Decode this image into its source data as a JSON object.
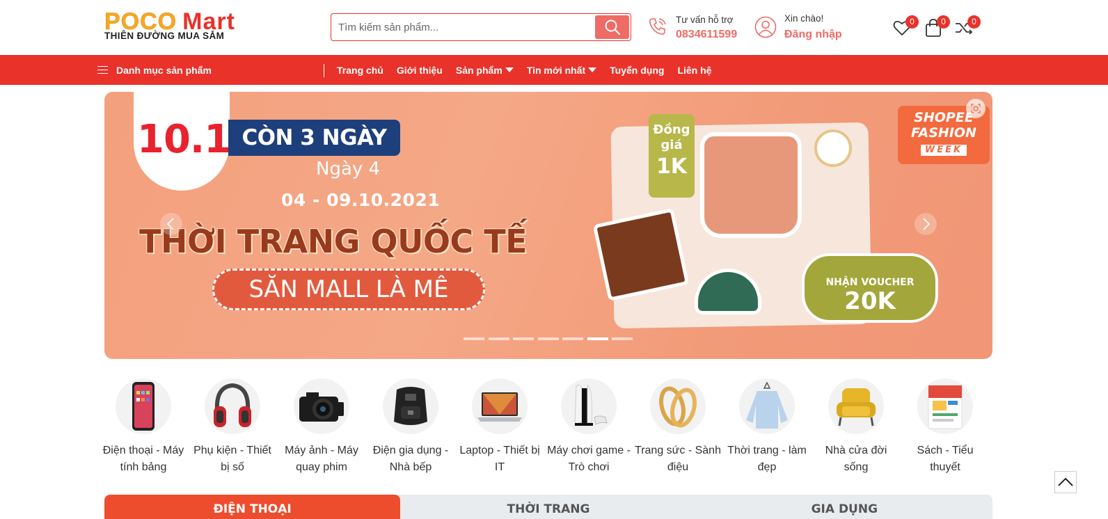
{
  "header": {
    "logo_poco": "POCO",
    "logo_mart": "Mart",
    "logo_tagline": "THIÊN ĐƯỜNG MUA SẮM",
    "search_placeholder": "Tìm kiếm sản phẩm...",
    "support_label": "Tư vấn hỗ trợ",
    "support_phone": "0834611599",
    "greeting": "Xin chào!",
    "login_label": "Đăng nhập",
    "wishlist_count": "0",
    "cart_count": "0",
    "compare_count": "0"
  },
  "nav": {
    "category_menu": "Danh mục sản phẩm",
    "links": [
      "Trang chủ",
      "Giới thiệu",
      "Sản phẩm",
      "Tin mới nhất",
      "Tuyển dụng",
      "Liên hệ"
    ]
  },
  "banner": {
    "date_big": "10.10",
    "countdown": "CÒN 3 NGÀY",
    "day": "Ngày 4",
    "date_range": "04 - 09.10.2021",
    "headline": "THỜI TRANG QUỐC TẾ",
    "pill": "SĂN MALL LÀ MÊ",
    "dongia_line1": "Đồng",
    "dongia_line2": "giá",
    "dongia_price": "1K",
    "voucher_line": "NHẬN VOUCHER",
    "voucher_value": "20K",
    "shopee_line1": "SHOPEE",
    "shopee_line2": "FASHION",
    "shopee_line3": "WEEK",
    "slide_count": 7,
    "active_slide": 6
  },
  "categories": [
    {
      "line1": "Điện thoại - Máy",
      "line2": "tính bảng",
      "icon": "phone-icon"
    },
    {
      "line1": "Phụ kiện - Thiết",
      "line2": "bị số",
      "icon": "headphones-icon"
    },
    {
      "line1": "Máy ảnh - Máy",
      "line2": "quay phim",
      "icon": "camera-icon"
    },
    {
      "line1": "Điện gia dụng -",
      "line2": "Nhà bếp",
      "icon": "air-fryer-icon"
    },
    {
      "line1": "Laptop - Thiết bị",
      "line2": "IT",
      "icon": "laptop-icon"
    },
    {
      "line1": "Máy chơi game -",
      "line2": "Trò chơi",
      "icon": "game-console-icon"
    },
    {
      "line1": "Trang sức - Sành",
      "line2": "điệu",
      "icon": "rings-icon"
    },
    {
      "line1": "Thời trang - làm",
      "line2": "đẹp",
      "icon": "sweater-icon"
    },
    {
      "line1": "Nhà cửa đời",
      "line2": "sống",
      "icon": "armchair-icon"
    },
    {
      "line1": "Sách - Tiểu",
      "line2": "thuyết",
      "icon": "book-icon"
    }
  ],
  "tabs": [
    "ĐIỆN THOẠI",
    "THỜI TRANG",
    "GIA DỤNG"
  ],
  "colors": {
    "brand_red": "#e8322a",
    "accent_orange": "#ee4d2d",
    "poco_yellow": "#f7a823"
  }
}
